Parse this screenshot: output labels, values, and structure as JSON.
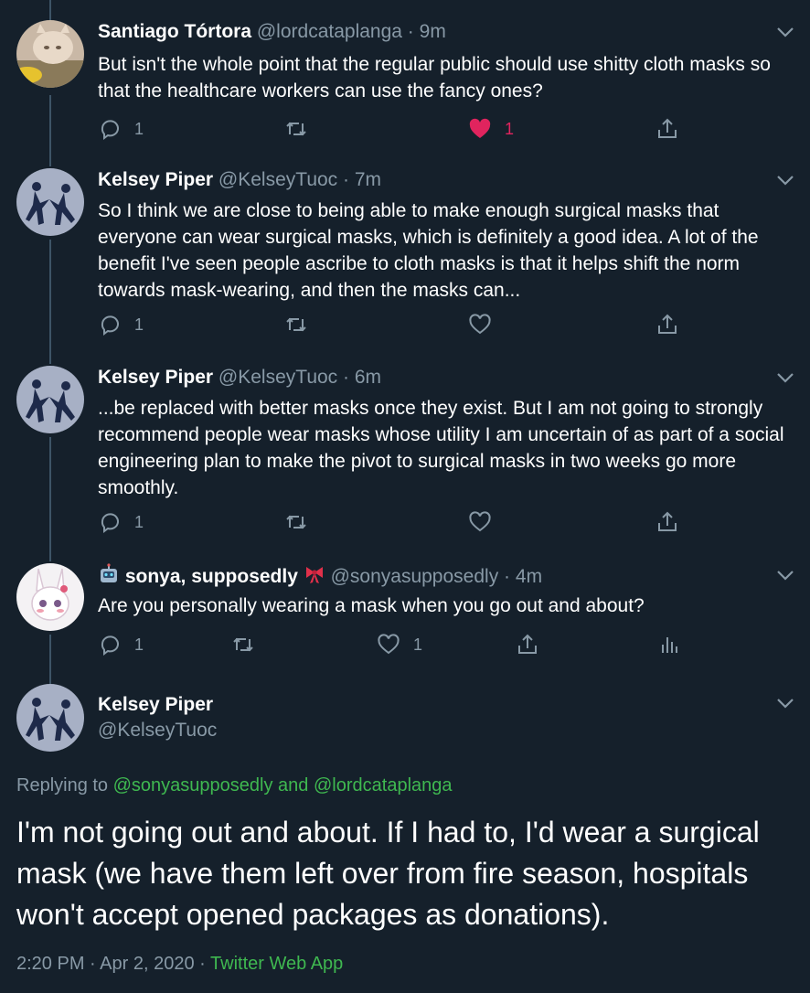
{
  "tweets": [
    {
      "name": "Santiago Tórtora",
      "handle": "@lordcataplanga",
      "time": "9m",
      "text": "But isn't the whole point that the regular public should use shitty cloth masks so that the healthcare workers can use the fancy ones?",
      "reply_count": "1",
      "like_count": "1",
      "liked": true
    },
    {
      "name": "Kelsey Piper",
      "handle": "@KelseyTuoc",
      "time": "7m",
      "text": "So I think we are close to being able to make enough surgical masks that everyone can wear surgical masks, which is definitely a good idea. A lot of the benefit I've seen people ascribe to cloth masks is that it helps shift the norm towards mask-wearing, and then the masks can...",
      "reply_count": "1"
    },
    {
      "name": "Kelsey Piper",
      "handle": "@KelseyTuoc",
      "time": "6m",
      "text": "...be replaced with better masks once they exist. But I am not going to strongly recommend people wear masks whose utility I am uncertain of as part of a social engineering plan to make the pivot to surgical masks in two weeks go more smoothly.",
      "reply_count": "1"
    },
    {
      "name": "sonya, supposedly",
      "handle": "@sonyasupposedly",
      "time": "4m",
      "text": "Are you personally wearing a mask when you go out and about?",
      "reply_count": "1",
      "like_count": "1"
    }
  ],
  "main_tweet": {
    "name": "Kelsey Piper",
    "handle": "@KelseyTuoc",
    "replying_prefix": "Replying to",
    "replying_user1": "@sonyasupposedly",
    "replying_and": "and",
    "replying_user2": "@lordcataplanga",
    "text": "I'm not going out and about. If I had to, I'd wear a surgical mask (we have them left over from fire season, hospitals won't accept opened packages as donations).",
    "time": "2:20 PM",
    "date": "Apr 2, 2020",
    "source": "Twitter Web App"
  },
  "colors": {
    "background": "#15202b",
    "secondary_text": "#8899a6",
    "like_red": "#e0245e",
    "link_green": "#3fb850"
  },
  "icons": [
    "reply-icon",
    "retweet-icon",
    "like-icon",
    "share-icon",
    "analytics-icon",
    "chevron-down-icon",
    "robot-emoji-icon",
    "ribbon-emoji-icon"
  ]
}
